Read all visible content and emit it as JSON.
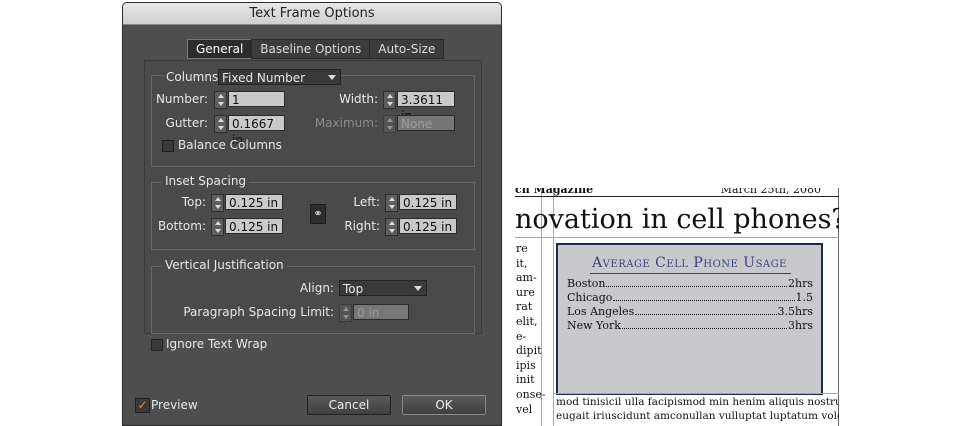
{
  "dialog": {
    "title": "Text Frame Options",
    "tabs": [
      "General",
      "Baseline Options",
      "Auto-Size"
    ],
    "columns": {
      "section_label": "Columns:",
      "type_value": "Fixed Number",
      "number_label": "Number:",
      "number_value": "1",
      "width_label": "Width:",
      "width_value": "3.3611 in",
      "gutter_label": "Gutter:",
      "gutter_value": "0.1667 in",
      "maximum_label": "Maximum:",
      "maximum_value": "None",
      "balance_label": "Balance Columns"
    },
    "inset": {
      "title": "Inset Spacing",
      "top_label": "Top:",
      "top_value": "0.125 in",
      "bottom_label": "Bottom:",
      "bottom_value": "0.125 in",
      "left_label": "Left:",
      "left_value": "0.125 in",
      "right_label": "Right:",
      "right_value": "0.125 in"
    },
    "vertical": {
      "title": "Vertical Justification",
      "align_label": "Align:",
      "align_value": "Top",
      "spacing_label": "Paragraph Spacing Limit:",
      "spacing_value": "0 in"
    },
    "ignore_wrap_label": "Ignore Text Wrap",
    "preview_label": "Preview",
    "cancel_label": "Cancel",
    "ok_label": "OK",
    "accent_color": "#e58a32"
  },
  "document": {
    "magazine": "ch Magazine",
    "date": "March 25th, 2080",
    "headline": "novation in cell phones?",
    "left_column": [
      "re",
      "it,",
      "am-",
      "ure",
      "rat",
      "elit,",
      "e-",
      "dipit",
      "ipis",
      "init",
      "onse-",
      "vel"
    ],
    "box": {
      "title": "Average Cell Phone Usage",
      "rows": [
        {
          "city": "Boston",
          "value": "2hrs"
        },
        {
          "city": "Chicago",
          "value": "1.5"
        },
        {
          "city": "Los Angeles",
          "value": "3.5hrs"
        },
        {
          "city": "New York",
          "value": "3hrs"
        }
      ],
      "title_color": "#3a3f7e",
      "border_color": "#1d2a4c",
      "fill_color": "#c9c9cd"
    },
    "bottom_lines": [
      "mod tinisicil ulla facipismod min henim aliquis nostrud",
      "eugait iriuscidunt amconullan vulluptat luptatum volor"
    ]
  }
}
